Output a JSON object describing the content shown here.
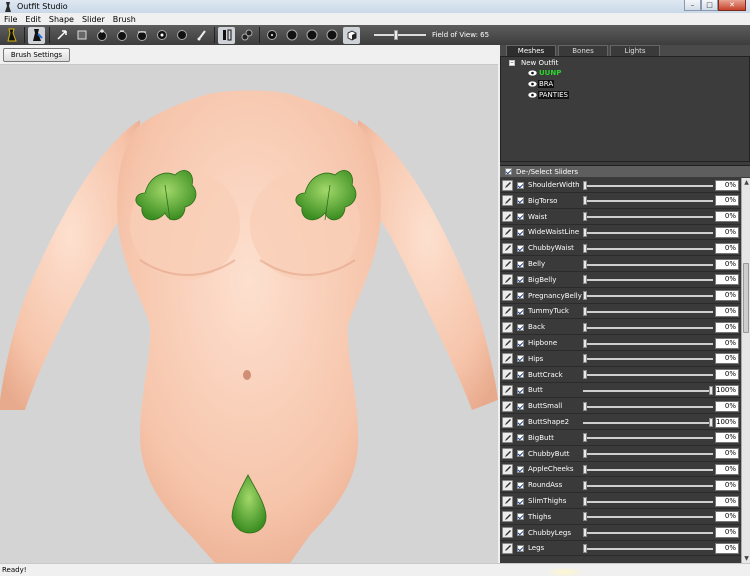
{
  "window": {
    "title": "Outfit Studio"
  },
  "menu": [
    "File",
    "Edit",
    "Shape",
    "Slider",
    "Brush"
  ],
  "toolbar": {
    "tools": [
      "select-mesh-icon",
      "transform-icon",
      "pointer-icon",
      "box-select-icon",
      "inflate-brush-icon",
      "deflate-brush-icon",
      "move-brush-icon",
      "smooth-brush-icon",
      "weight-brush-icon",
      "paint-brush-icon",
      "mirror-icon",
      "symmetry-icon",
      "vertex-small-icon",
      "vertex-medium-icon",
      "vertex-large-icon",
      "wireframe-icon",
      "lighting-icon",
      "texture-icon"
    ],
    "fov_label": "Field of View: 65",
    "fov_value": 65
  },
  "brush_settings_label": "Brush Settings >>",
  "tabs": [
    "Meshes",
    "Bones",
    "Lights"
  ],
  "active_tab": "Meshes",
  "tree": {
    "root": "New Outfit",
    "meshes": [
      {
        "name": "UUNP",
        "selected": true
      },
      {
        "name": "BRA",
        "selected": false
      },
      {
        "name": "PANTIES",
        "selected": false
      }
    ]
  },
  "sliders_header": "De-/Select Sliders",
  "sliders": [
    {
      "name": "ShoulderWidth",
      "value": "0%",
      "level": 0.0
    },
    {
      "name": "BigTorso",
      "value": "0%",
      "level": 0.0
    },
    {
      "name": "Waist",
      "value": "0%",
      "level": 0.0
    },
    {
      "name": "WideWaistLine",
      "value": "0%",
      "level": 0.0
    },
    {
      "name": "ChubbyWaist",
      "value": "0%",
      "level": 0.0
    },
    {
      "name": "Belly",
      "value": "0%",
      "level": 0.0
    },
    {
      "name": "BigBelly",
      "value": "0%",
      "level": 0.0
    },
    {
      "name": "PregnancyBelly",
      "value": "0%",
      "level": 0.0
    },
    {
      "name": "TummyTuck",
      "value": "0%",
      "level": 0.0
    },
    {
      "name": "Back",
      "value": "0%",
      "level": 0.0
    },
    {
      "name": "Hipbone",
      "value": "0%",
      "level": 0.0
    },
    {
      "name": "Hips",
      "value": "0%",
      "level": 0.0
    },
    {
      "name": "ButtCrack",
      "value": "0%",
      "level": 0.0
    },
    {
      "name": "Butt",
      "value": "100%",
      "level": 1.0
    },
    {
      "name": "ButtSmall",
      "value": "0%",
      "level": 0.0
    },
    {
      "name": "ButtShape2",
      "value": "100%",
      "level": 1.0
    },
    {
      "name": "BigButt",
      "value": "0%",
      "level": 0.0
    },
    {
      "name": "ChubbyButt",
      "value": "0%",
      "level": 0.0
    },
    {
      "name": "AppleCheeks",
      "value": "0%",
      "level": 0.0
    },
    {
      "name": "RoundAss",
      "value": "0%",
      "level": 0.0
    },
    {
      "name": "SlimThighs",
      "value": "0%",
      "level": 0.0
    },
    {
      "name": "Thighs",
      "value": "0%",
      "level": 0.0
    },
    {
      "name": "ChubbyLegs",
      "value": "0%",
      "level": 0.0
    },
    {
      "name": "Legs",
      "value": "0%",
      "level": 0.0
    }
  ],
  "status": "Ready!",
  "colors": {
    "toolbar": "#4a4a4a",
    "panel": "#3c3c3c",
    "selected_mesh": "#2ed32e",
    "viewport": "#d4d4d4",
    "skin": "#f7c9b0",
    "leaf": "#5fb53a"
  }
}
